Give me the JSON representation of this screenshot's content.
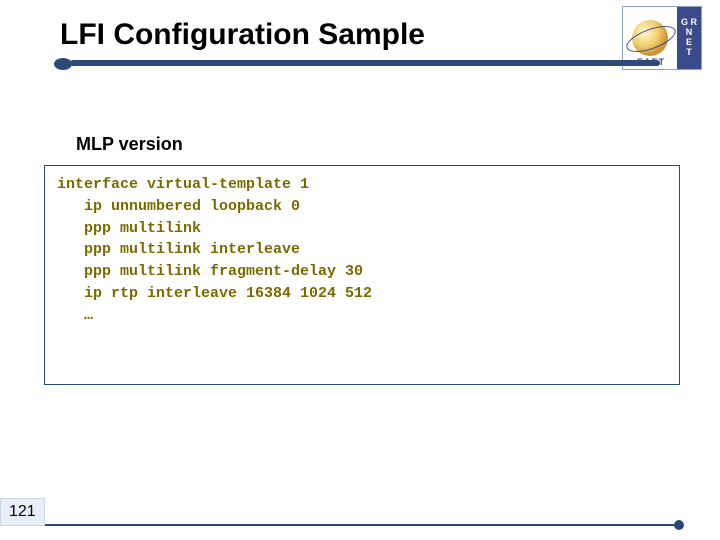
{
  "title": "LFI Configuration Sample",
  "subtitle": "MLP version",
  "code_lines": [
    "interface virtual-template 1",
    "   ip unnumbered loopback 0",
    "   ppp multilink",
    "   ppp multilink interleave",
    "   ppp multilink fragment-delay 30",
    "   ip rtp interleave 16384 1024 512",
    "   …"
  ],
  "page_number": "121",
  "logo": {
    "right_text_top": "G R",
    "right_text_mid1": "N",
    "right_text_mid2": "E",
    "right_text_bot": "T",
    "bottom_text": "ΕΔΕΤ"
  }
}
